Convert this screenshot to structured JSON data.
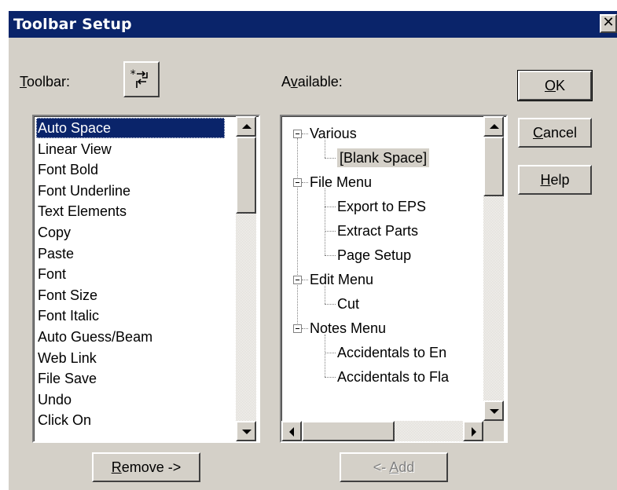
{
  "window": {
    "title": "Toolbar Setup",
    "close_glyph": "✕"
  },
  "toolbar_label": {
    "mnemonic": "T",
    "rest": "oolbar:"
  },
  "available_label": {
    "pre": "A",
    "mnemonic": "v",
    "rest": "ailable:"
  },
  "toolbar_icon": "toolbar-swap-icon",
  "toolbar_items": [
    "Auto Space",
    "Linear View",
    "Font Bold",
    "Font Underline",
    "Text Elements",
    "Copy",
    "Paste",
    "Font",
    "Font Size",
    "Font Italic",
    "Auto Guess/Beam",
    "Web Link",
    "File Save",
    "Undo",
    "Click On"
  ],
  "selected_toolbar_item": "Auto Space",
  "tree": {
    "groups": [
      {
        "label": "Various",
        "children": [
          "[Blank Space]"
        ]
      },
      {
        "label": "File Menu",
        "children": [
          "Export to EPS",
          "Extract Parts",
          "Page Setup"
        ]
      },
      {
        "label": "Edit Menu",
        "children": [
          "Cut"
        ]
      },
      {
        "label": "Notes Menu",
        "children": [
          "Accidentals to En",
          "Accidentals to Fla"
        ]
      }
    ],
    "selected": "[Blank Space]"
  },
  "buttons": {
    "ok": {
      "mnemonic": "O",
      "rest": "K"
    },
    "cancel": {
      "mnemonic": "C",
      "rest": "ancel"
    },
    "help": {
      "mnemonic": "H",
      "rest": "elp"
    },
    "remove": {
      "mnemonic": "R",
      "rest": "emove ->"
    },
    "add": {
      "pre": "<- ",
      "mnemonic": "A",
      "rest": "dd"
    }
  },
  "colors": {
    "titlebar": "#0a246a",
    "face": "#d4d0c8",
    "selection": "#0a246a"
  }
}
